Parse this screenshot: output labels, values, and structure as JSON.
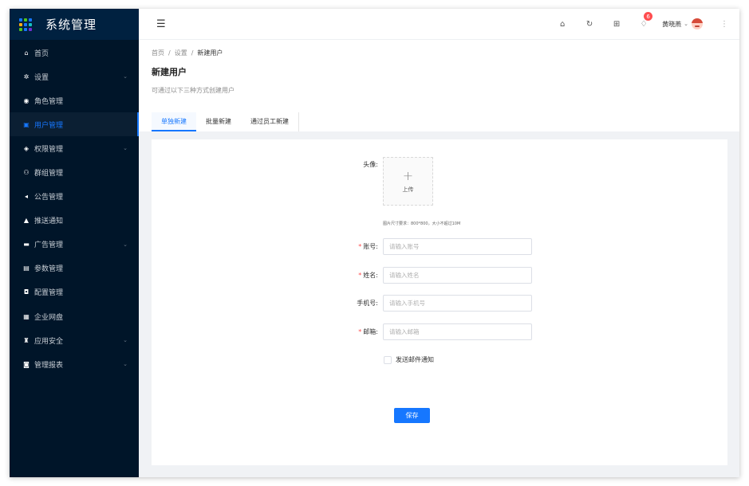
{
  "app": {
    "title": "系统管理",
    "accent": "#1677ff",
    "sidebar_bg": "#001529"
  },
  "sidebar": {
    "items": [
      {
        "label": "首页",
        "icon": "home-icon",
        "glyph": "⌂",
        "has_children": false,
        "active": false
      },
      {
        "label": "设置",
        "icon": "gear-icon",
        "glyph": "✲",
        "has_children": true,
        "active": false
      },
      {
        "label": "角色管理",
        "icon": "user-role-icon",
        "glyph": "◉",
        "has_children": false,
        "active": false
      },
      {
        "label": "用户管理",
        "icon": "user-card-icon",
        "glyph": "▣",
        "has_children": false,
        "active": true
      },
      {
        "label": "权限管理",
        "icon": "shield-icon",
        "glyph": "◈",
        "has_children": true,
        "active": false
      },
      {
        "label": "群组管理",
        "icon": "group-icon",
        "glyph": "⚇",
        "has_children": false,
        "active": false
      },
      {
        "label": "公告管理",
        "icon": "megaphone-icon",
        "glyph": "◂",
        "has_children": false,
        "active": false
      },
      {
        "label": "推送通知",
        "icon": "bell-icon",
        "glyph": "▲",
        "has_children": false,
        "active": false
      },
      {
        "label": "广告管理",
        "icon": "picture-icon",
        "glyph": "▬",
        "has_children": true,
        "active": false
      },
      {
        "label": "参数管理",
        "icon": "params-icon",
        "glyph": "▤",
        "has_children": false,
        "active": false
      },
      {
        "label": "配置管理",
        "icon": "config-icon",
        "glyph": "◘",
        "has_children": false,
        "active": false
      },
      {
        "label": "企业网盘",
        "icon": "appstore-icon",
        "glyph": "▦",
        "has_children": false,
        "active": false
      },
      {
        "label": "应用安全",
        "icon": "security-icon",
        "glyph": "♜",
        "has_children": true,
        "active": false
      },
      {
        "label": "管理报表",
        "icon": "report-icon",
        "glyph": "◙",
        "has_children": true,
        "active": false
      }
    ]
  },
  "topbar": {
    "notification_count": "6",
    "user_name": "黄晓燕"
  },
  "header": {
    "breadcrumb": [
      "首页",
      "设置",
      "新建用户"
    ],
    "title": "新建用户",
    "description": "可通过以下三种方式创建用户",
    "tabs": [
      {
        "label": "单独新建",
        "active": true
      },
      {
        "label": "批量新建",
        "active": false
      },
      {
        "label": "通过员工新建",
        "active": false
      }
    ]
  },
  "form": {
    "avatar_label": "头像:",
    "upload_text": "上传",
    "upload_hint": "图片尺寸要求：800*800，大小不超过10M",
    "fields": [
      {
        "label": "账号:",
        "required": true,
        "placeholder": "请输入账号",
        "value": ""
      },
      {
        "label": "姓名:",
        "required": true,
        "placeholder": "请输入姓名",
        "value": ""
      },
      {
        "label": "手机号:",
        "required": false,
        "placeholder": "请输入手机号",
        "value": ""
      },
      {
        "label": "邮箱:",
        "required": true,
        "placeholder": "请输入邮箱",
        "value": ""
      }
    ],
    "email_notify_label": "发送邮件通知",
    "email_notify_checked": false,
    "save_label": "保存"
  }
}
